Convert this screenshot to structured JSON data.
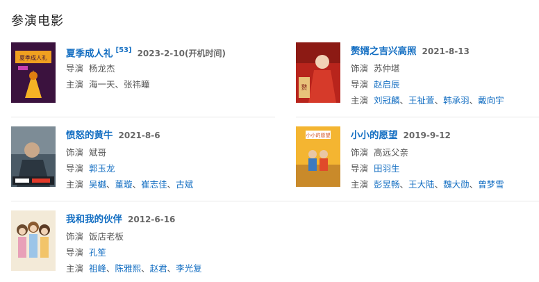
{
  "section": {
    "title": "参演电影"
  },
  "labels": {
    "role": "饰演",
    "director": "导演",
    "cast": "主演"
  },
  "movies": [
    {
      "title": "夏季成人礼",
      "ref": "[53]",
      "date": "2023-2-10(开机时间)",
      "director": "杨龙杰",
      "cast": [
        "海一天",
        "张祎瞳"
      ]
    },
    {
      "title": "赘婿之吉兴高照",
      "date": "2021-8-13",
      "role": "苏仲堪",
      "director": "赵启辰",
      "cast": [
        "刘冠麟",
        "王祉萱",
        "韩承羽",
        "戴向宇"
      ]
    },
    {
      "title": "愤怒的黄牛",
      "date": "2021-8-6",
      "role": "斌哥",
      "director": "郭玉龙",
      "cast": [
        "吴樾",
        "董璇",
        "崔志佳",
        "古斌"
      ]
    },
    {
      "title": "小小的愿望",
      "date": "2019-9-12",
      "role": "高远父亲",
      "director": "田羽生",
      "cast": [
        "彭昱畅",
        "王大陆",
        "魏大勋",
        "曾梦雪"
      ]
    },
    {
      "title": "我和我的伙伴",
      "date": "2012-6-16",
      "role": "饭店老板",
      "director": "孔笙",
      "cast": [
        "祖峰",
        "陈雅熙",
        "赵君",
        "李光复"
      ]
    }
  ],
  "colors": {
    "link": "#136ec2",
    "text": "#555555",
    "divider": "#e8e8e8"
  }
}
